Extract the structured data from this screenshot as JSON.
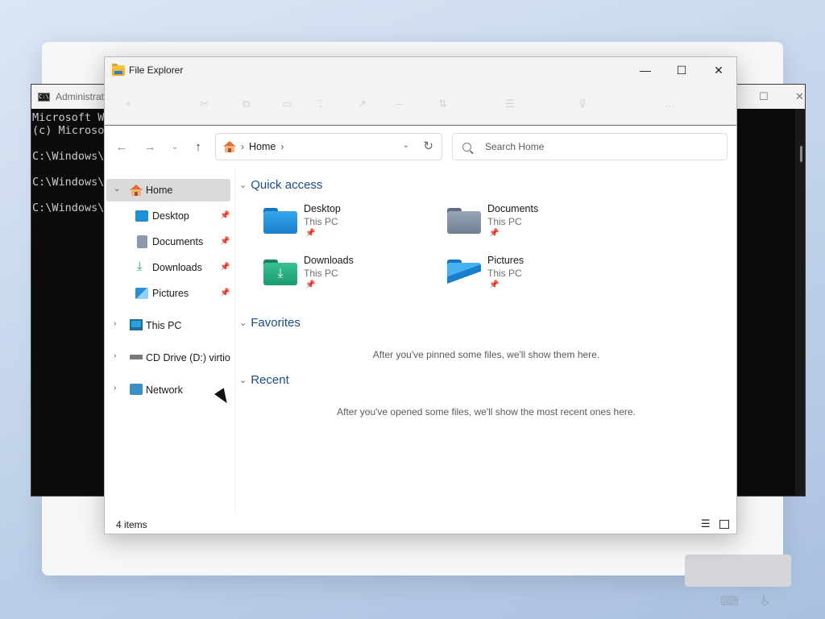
{
  "cmd": {
    "title": "Administrat",
    "lines": [
      "Microsoft Wi",
      "(c) Microso",
      "",
      "C:\\Windows\\S",
      "",
      "C:\\Windows\\S",
      "",
      "C:\\Windows\\S"
    ]
  },
  "explorer": {
    "title": "File Explorer",
    "window_controls": {
      "minimize": "—",
      "maximize": "☐",
      "close": "✕"
    },
    "address": {
      "location": "Home",
      "separator": "›"
    },
    "search": {
      "placeholder": "Search Home"
    },
    "sidebar": {
      "items": [
        {
          "label": "Home",
          "icon": "home-icon",
          "selected": true
        },
        {
          "label": "Desktop",
          "icon": "desktop-icon",
          "pinned": true
        },
        {
          "label": "Documents",
          "icon": "documents-icon",
          "pinned": true
        },
        {
          "label": "Downloads",
          "icon": "downloads-icon",
          "pinned": true
        },
        {
          "label": "Pictures",
          "icon": "pictures-icon",
          "pinned": true
        },
        {
          "label": "This PC",
          "icon": "this-pc-icon"
        },
        {
          "label": "CD Drive (D:) virtio-win",
          "icon": "cd-drive-icon"
        },
        {
          "label": "Network",
          "icon": "network-icon"
        }
      ]
    },
    "content": {
      "quick_access": {
        "title": "Quick access",
        "items": [
          {
            "name": "Desktop",
            "location": "This PC",
            "color": "#1f8fd6"
          },
          {
            "name": "Documents",
            "location": "This PC",
            "color": "#7f8fa3"
          },
          {
            "name": "Downloads",
            "location": "This PC",
            "color": "#1fa47a"
          },
          {
            "name": "Pictures",
            "location": "This PC",
            "color": "#1f8fd6"
          }
        ]
      },
      "favorites": {
        "title": "Favorites",
        "empty": "After you've pinned some files, we'll show them here."
      },
      "recent": {
        "title": "Recent",
        "empty": "After you've opened some files, we'll show the most recent ones here."
      }
    },
    "status": {
      "count": "4 items"
    },
    "colors": {
      "section_header": "#1c4d84",
      "selected_bg": "#dadada"
    }
  }
}
